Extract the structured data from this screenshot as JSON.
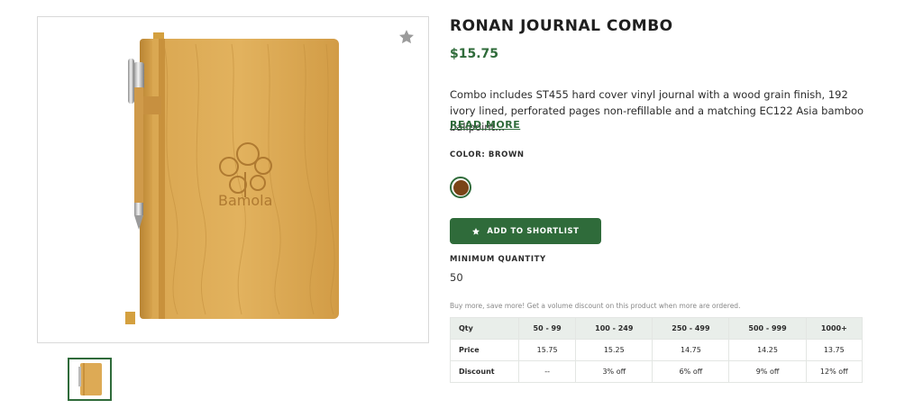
{
  "product": {
    "title": "RONAN JOURNAL COMBO",
    "price": "$15.75",
    "description": "Combo includes ST455 hard cover vinyl journal with a wood grain finish, 192 ivory lined, perforated pages non-refillable and a matching EC122 Asia bamboo ballpoint...",
    "read_more": "READ MORE",
    "image_logo_text": "Bamola"
  },
  "color": {
    "label": "COLOR: BROWN",
    "swatch_hex": "#7a4418"
  },
  "actions": {
    "shortlist_label": "ADD TO SHORTLIST",
    "shortlist_icon": "star-icon",
    "favorite_icon": "star-icon"
  },
  "minimum": {
    "label": "MINIMUM QUANTITY",
    "value": "50"
  },
  "pricing": {
    "promo": "Buy more, save more! Get a volume discount on this product when more are ordered.",
    "header": [
      "Qty",
      "50 - 99",
      "100 - 249",
      "250 - 499",
      "500 - 999",
      "1000+"
    ],
    "rows": [
      [
        "Price",
        "15.75",
        "15.25",
        "14.75",
        "14.25",
        "13.75"
      ],
      [
        "Discount",
        "--",
        "3% off",
        "6% off",
        "9% off",
        "12% off"
      ]
    ]
  },
  "colors": {
    "accent": "#2f6b3a",
    "table_header_bg": "#e9eeea"
  }
}
